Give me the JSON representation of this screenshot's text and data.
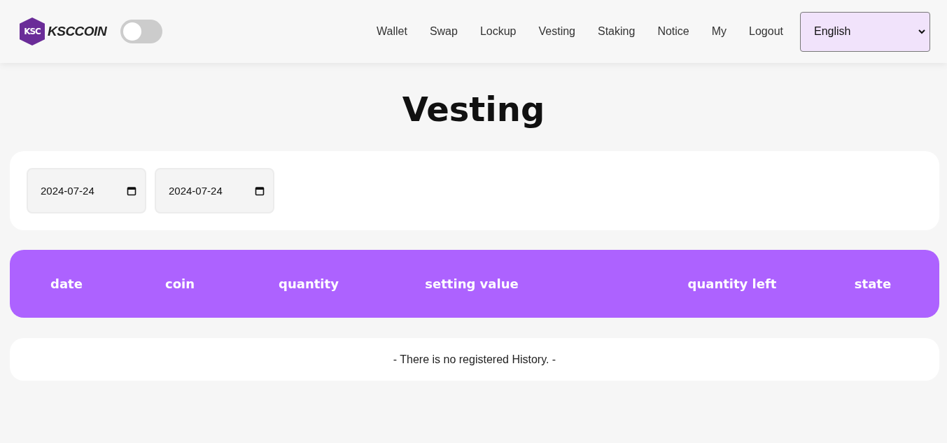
{
  "header": {
    "logo_mark": "KSC",
    "logo_text": "KSCCOIN",
    "theme_toggle": {
      "on": false
    },
    "nav": [
      "Wallet",
      "Swap",
      "Lockup",
      "Vesting",
      "Staking",
      "Notice",
      "My",
      "Logout"
    ],
    "language": {
      "value": "English"
    }
  },
  "title": "Vesting",
  "filters": {
    "start_date": "2024-07-24",
    "end_date": "2024-07-24"
  },
  "table": {
    "columns": [
      "date",
      "coin",
      "quantity",
      "setting value",
      "quantity left",
      "state"
    ],
    "empty_message": "- There is no registered History. -"
  }
}
